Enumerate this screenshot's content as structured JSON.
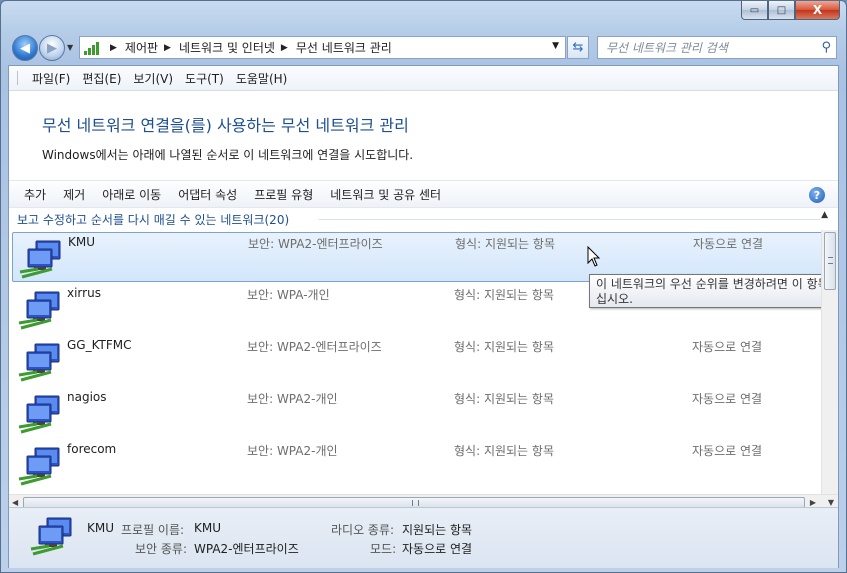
{
  "window": {
    "caption": {
      "minimize": "▭",
      "maximize": "□",
      "close": "X"
    }
  },
  "address": {
    "crumbs": [
      "제어판",
      "네트워크 및 인터넷",
      "무선 네트워크 관리"
    ],
    "search_placeholder": "무선 네트워크 관리 검색"
  },
  "menu": [
    "파일(F)",
    "편집(E)",
    "보기(V)",
    "도구(T)",
    "도움말(H)"
  ],
  "header": {
    "title": "무선 네트워크 연결을(를) 사용하는 무선 네트워크 관리",
    "description": "Windows에서는 아래에 나열된 순서로 이 네트워크에 연결을 시도합니다."
  },
  "commands": [
    "추가",
    "제거",
    "아래로 이동",
    "어댑터 속성",
    "프로필 유형",
    "네트워크 및 공유 센터"
  ],
  "group": {
    "label": "보고 수정하고 순서를 다시 매길 수 있는 네트워크(20)"
  },
  "networks": [
    {
      "name": "KMU",
      "security": "보안: WPA2-엔터프라이즈",
      "type": "형식: 지원되는 항목",
      "mode": "자동으로 연결",
      "selected": true
    },
    {
      "name": "xirrus",
      "security": "보안: WPA-개인",
      "type": "형식: 지원되는 항목",
      "mode": "",
      "selected": false
    },
    {
      "name": "GG_KTFMC",
      "security": "보안: WPA2-엔터프라이즈",
      "type": "형식: 지원되는 항목",
      "mode": "자동으로 연결",
      "selected": false
    },
    {
      "name": "nagios",
      "security": "보안: WPA2-개인",
      "type": "형식: 지원되는 항목",
      "mode": "자동으로 연결",
      "selected": false
    },
    {
      "name": "forecom",
      "security": "보안: WPA2-개인",
      "type": "형식: 지원되는 항목",
      "mode": "자동으로 연결",
      "selected": false
    }
  ],
  "tooltip": {
    "line1": "이 네트워크의 우선 순위를 변경하려면 이 항목을",
    "line2": "십시오."
  },
  "details": {
    "name": "KMU",
    "profile_label": "프로필 이름:",
    "profile_value": "KMU",
    "security_label": "보안 종류:",
    "security_value": "WPA2-엔터프라이즈",
    "radio_label": "라디오 종류:",
    "radio_value": "지원되는 항목",
    "mode_label": "모드:",
    "mode_value": "자동으로 연결"
  },
  "colors": {
    "accent": "#1d4f91",
    "selection": "#d3e6fb",
    "wifi_green": "#3d9b2f"
  }
}
